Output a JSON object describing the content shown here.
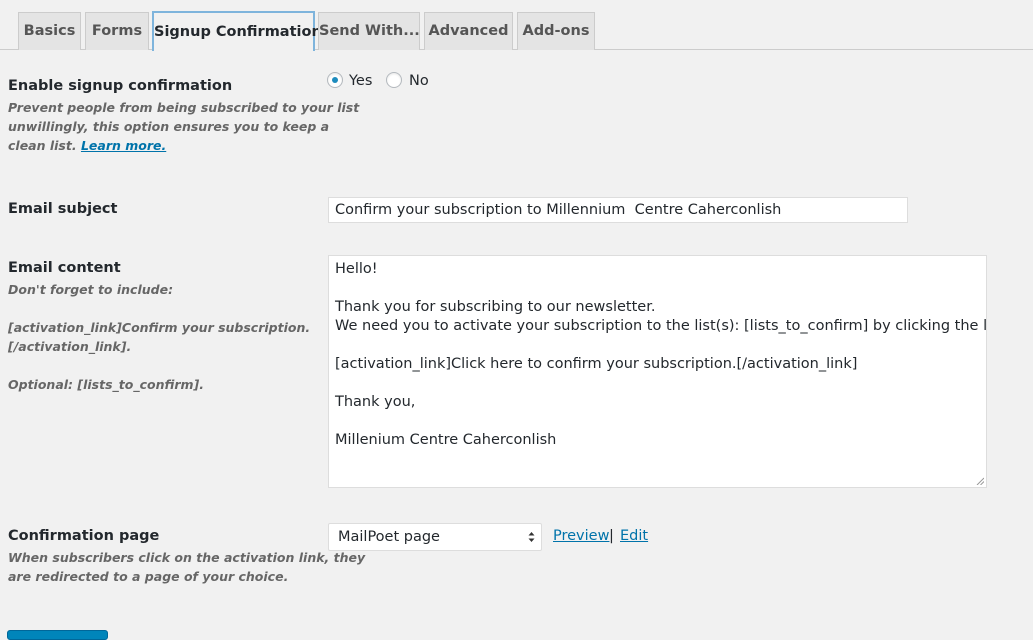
{
  "tabs": [
    {
      "label": "Basics"
    },
    {
      "label": "Forms"
    },
    {
      "label": "Signup Confirmation",
      "active": true
    },
    {
      "label": "Send With..."
    },
    {
      "label": "Advanced"
    },
    {
      "label": "Add-ons"
    }
  ],
  "enable_confirmation": {
    "label": "Enable signup confirmation",
    "desc_line1": "Prevent people from being subscribed to your list",
    "desc_line2": "unwillingly, this option ensures you to keep a",
    "desc_line3_prefix": "clean list. ",
    "learn_more": "Learn more.",
    "option_yes": "Yes",
    "option_no": "No",
    "selected": "Yes"
  },
  "email_subject": {
    "label": "Email subject",
    "value": "Confirm your subscription to Millennium  Centre Caherconlish"
  },
  "email_content": {
    "label": "Email content",
    "desc_line1": "Don't forget to include:",
    "desc_line2": "[activation_link]Confirm your subscription.",
    "desc_line3": "[/activation_link].",
    "desc_line4": "Optional: [lists_to_confirm].",
    "lines": [
      "Hello!",
      "",
      "Thank you for subscribing to our newsletter.",
      "We need you to activate your subscription to the list(s): [lists_to_confirm] by clicking the link below:",
      "",
      "[activation_link]Click here to confirm your subscription.[/activation_link]",
      "",
      "Thank you,",
      "",
      "Millenium Centre Caherconlish"
    ]
  },
  "confirmation_page": {
    "label": "Confirmation page",
    "desc_line1": "When subscribers click on the activation link, they",
    "desc_line2": "are redirected to a page of your choice.",
    "selected": "MailPoet page",
    "preview": "Preview",
    "separator": "|",
    "edit": "Edit"
  },
  "colors": {
    "background": "#f1f1f1",
    "link": "#0073aa",
    "radio_dot": "#1e8cbe",
    "active_tab_border": "#7eb4dc",
    "button": "#0085ba"
  }
}
